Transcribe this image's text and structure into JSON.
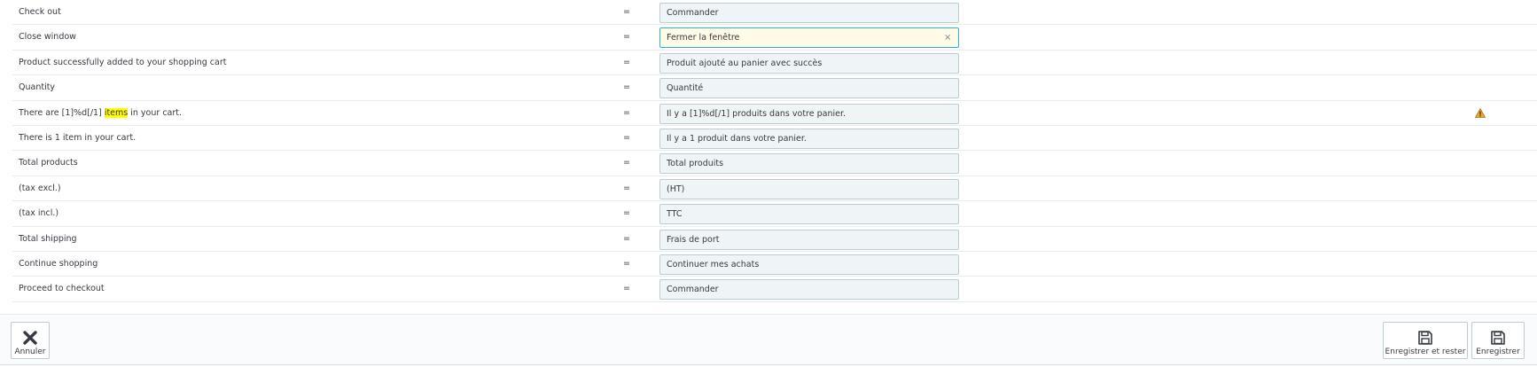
{
  "rows": [
    {
      "source_parts": [
        "Check out"
      ],
      "value": "Commander"
    },
    {
      "source_parts": [
        "Close window"
      ],
      "value": "Fermer la fenêtre",
      "focused": true
    },
    {
      "source_parts": [
        "Product successfully added to your shopping cart"
      ],
      "value": "Produit ajouté au panier avec succès"
    },
    {
      "source_parts": [
        "Quantity"
      ],
      "value": "Quantité"
    },
    {
      "source_parts": [
        "There are [1]%d[/1] ",
        "items",
        " in your cart."
      ],
      "value": "Il y a [1]%d[/1] produits dans votre panier.",
      "warning": true
    },
    {
      "source_parts": [
        "There is 1 item in your cart."
      ],
      "value": "Il y a 1 produit dans votre panier."
    },
    {
      "source_parts": [
        "Total products"
      ],
      "value": "Total produits"
    },
    {
      "source_parts": [
        "(tax excl.)"
      ],
      "value": "(HT)"
    },
    {
      "source_parts": [
        "(tax incl.)"
      ],
      "value": "TTC"
    },
    {
      "source_parts": [
        "Total shipping"
      ],
      "value": "Frais de port"
    },
    {
      "source_parts": [
        "Continue shopping"
      ],
      "value": "Continuer mes achats"
    },
    {
      "source_parts": [
        "Proceed to checkout"
      ],
      "value": "Commander"
    }
  ],
  "equals_sign": "=",
  "clear_glyph": "×",
  "footer": {
    "cancel_label": "Annuler",
    "save_stay_label": "Enregistrer et rester",
    "save_label": "Enregistrer"
  },
  "icons": {
    "cancel": "close-icon",
    "save": "floppy-disk-icon",
    "warning": "warning-triangle-icon"
  },
  "colors": {
    "highlight": "#ffff00",
    "input_bg": "#eff5f6",
    "input_focus_bg": "#fffbe6",
    "focus_border": "#25b9d7",
    "warning": "#f5a623"
  }
}
